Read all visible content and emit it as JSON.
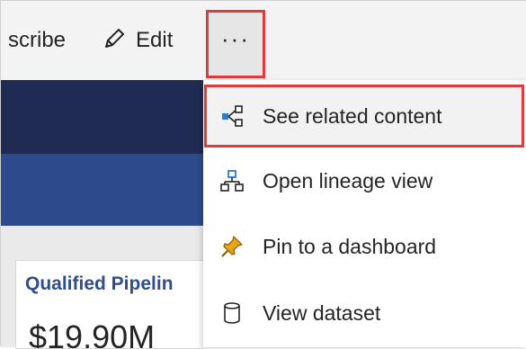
{
  "toolbar": {
    "subscribe_label": "scribe",
    "edit_label": "Edit",
    "more_label": "···"
  },
  "menu": {
    "items": [
      {
        "label": "See related content",
        "icon": "related-content-icon"
      },
      {
        "label": "Open lineage view",
        "icon": "lineage-icon"
      },
      {
        "label": "Pin to a dashboard",
        "icon": "pin-icon"
      },
      {
        "label": "View dataset",
        "icon": "dataset-icon"
      }
    ]
  },
  "card": {
    "title": "Qualified Pipelin",
    "value": "$19.90M"
  },
  "colors": {
    "highlight_border": "#e03a3a",
    "header_dark": "#1f2b53",
    "header_mid": "#2d4a8c",
    "card_title": "#2f4e8a",
    "pin": "#e8a317",
    "related_icon": "#2b7cd3"
  }
}
